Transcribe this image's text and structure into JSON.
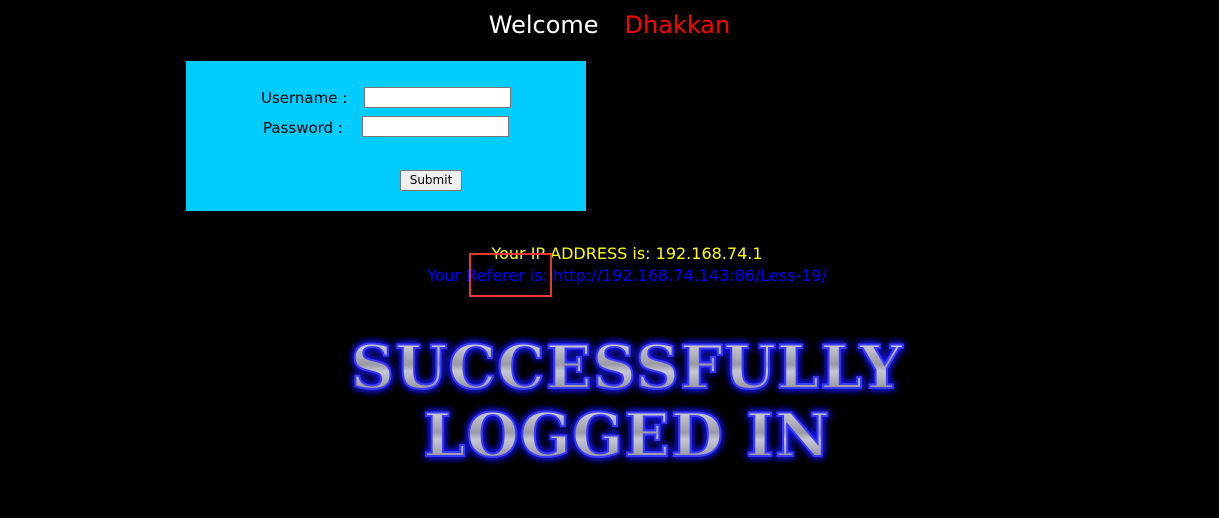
{
  "header": {
    "welcome_label": "Welcome",
    "user_name": "Dhakkan"
  },
  "login_form": {
    "username_label": "Username :",
    "password_label": "Password :",
    "username_value": "",
    "password_value": "",
    "submit_label": "Submit"
  },
  "info": {
    "ip_text": "Your IP ADDRESS is: 192.168.74.1",
    "referer_text": "Your Referer is: http://192.168.74.143:86/Less-19/"
  },
  "success_banner": {
    "line1": "SUCCESSFULLY",
    "line2": "LOGGED IN"
  },
  "colors": {
    "background": "#000000",
    "form_bg": "#00ccff",
    "welcome_user": "#ff0000",
    "ip_text": "#ffff00",
    "referer_text": "#0000ff",
    "highlight": "#e53935"
  }
}
